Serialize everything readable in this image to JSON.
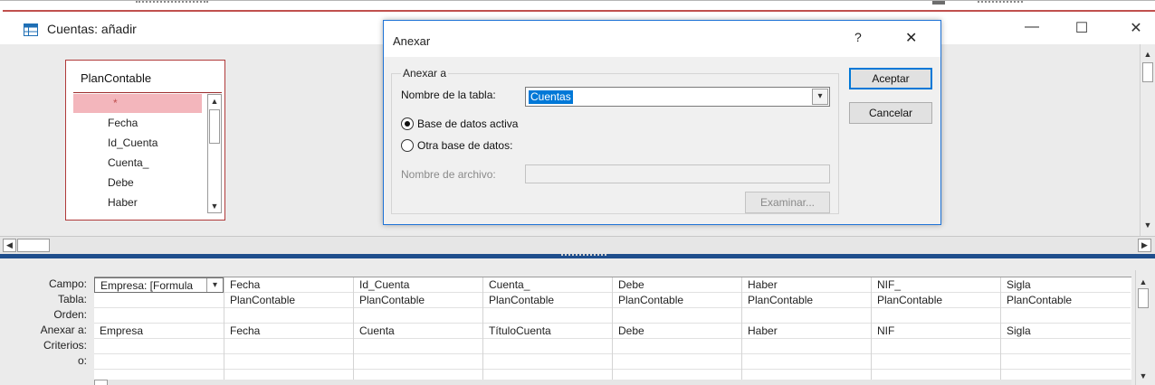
{
  "window": {
    "title": "Cuentas: añadir",
    "minimize": "—",
    "maximize": "☐",
    "close": "✕"
  },
  "table": {
    "name": "PlanContable",
    "fields": [
      "*",
      "Fecha",
      "Id_Cuenta",
      "Cuenta_",
      "Debe",
      "Haber"
    ]
  },
  "grid": {
    "row_labels": [
      "Campo:",
      "Tabla:",
      "Orden:",
      "Anexar a:",
      "Criterios:",
      "o:"
    ],
    "columns": [
      {
        "campo": "Empresa: [Formula",
        "tabla": "",
        "anexar": "Empresa"
      },
      {
        "campo": "Fecha",
        "tabla": "PlanContable",
        "anexar": "Fecha"
      },
      {
        "campo": "Id_Cuenta",
        "tabla": "PlanContable",
        "anexar": "Cuenta"
      },
      {
        "campo": "Cuenta_",
        "tabla": "PlanContable",
        "anexar": "TítuloCuenta"
      },
      {
        "campo": "Debe",
        "tabla": "PlanContable",
        "anexar": "Debe"
      },
      {
        "campo": "Haber",
        "tabla": "PlanContable",
        "anexar": "Haber"
      },
      {
        "campo": "NIF_",
        "tabla": "PlanContable",
        "anexar": "NIF"
      },
      {
        "campo": "Sigla",
        "tabla": "PlanContable",
        "anexar": "Sigla"
      }
    ]
  },
  "dialog": {
    "title": "Anexar",
    "help": "?",
    "close": "✕",
    "group_label": "Anexar a",
    "table_name_label": "Nombre de la tabla:",
    "table_name_value": "Cuentas",
    "radio_active": "Base de datos activa",
    "radio_other": "Otra base de datos:",
    "file_label": "Nombre de archivo:",
    "file_value": "",
    "browse": "Examinar...",
    "ok": "Aceptar",
    "cancel": "Cancelar"
  }
}
